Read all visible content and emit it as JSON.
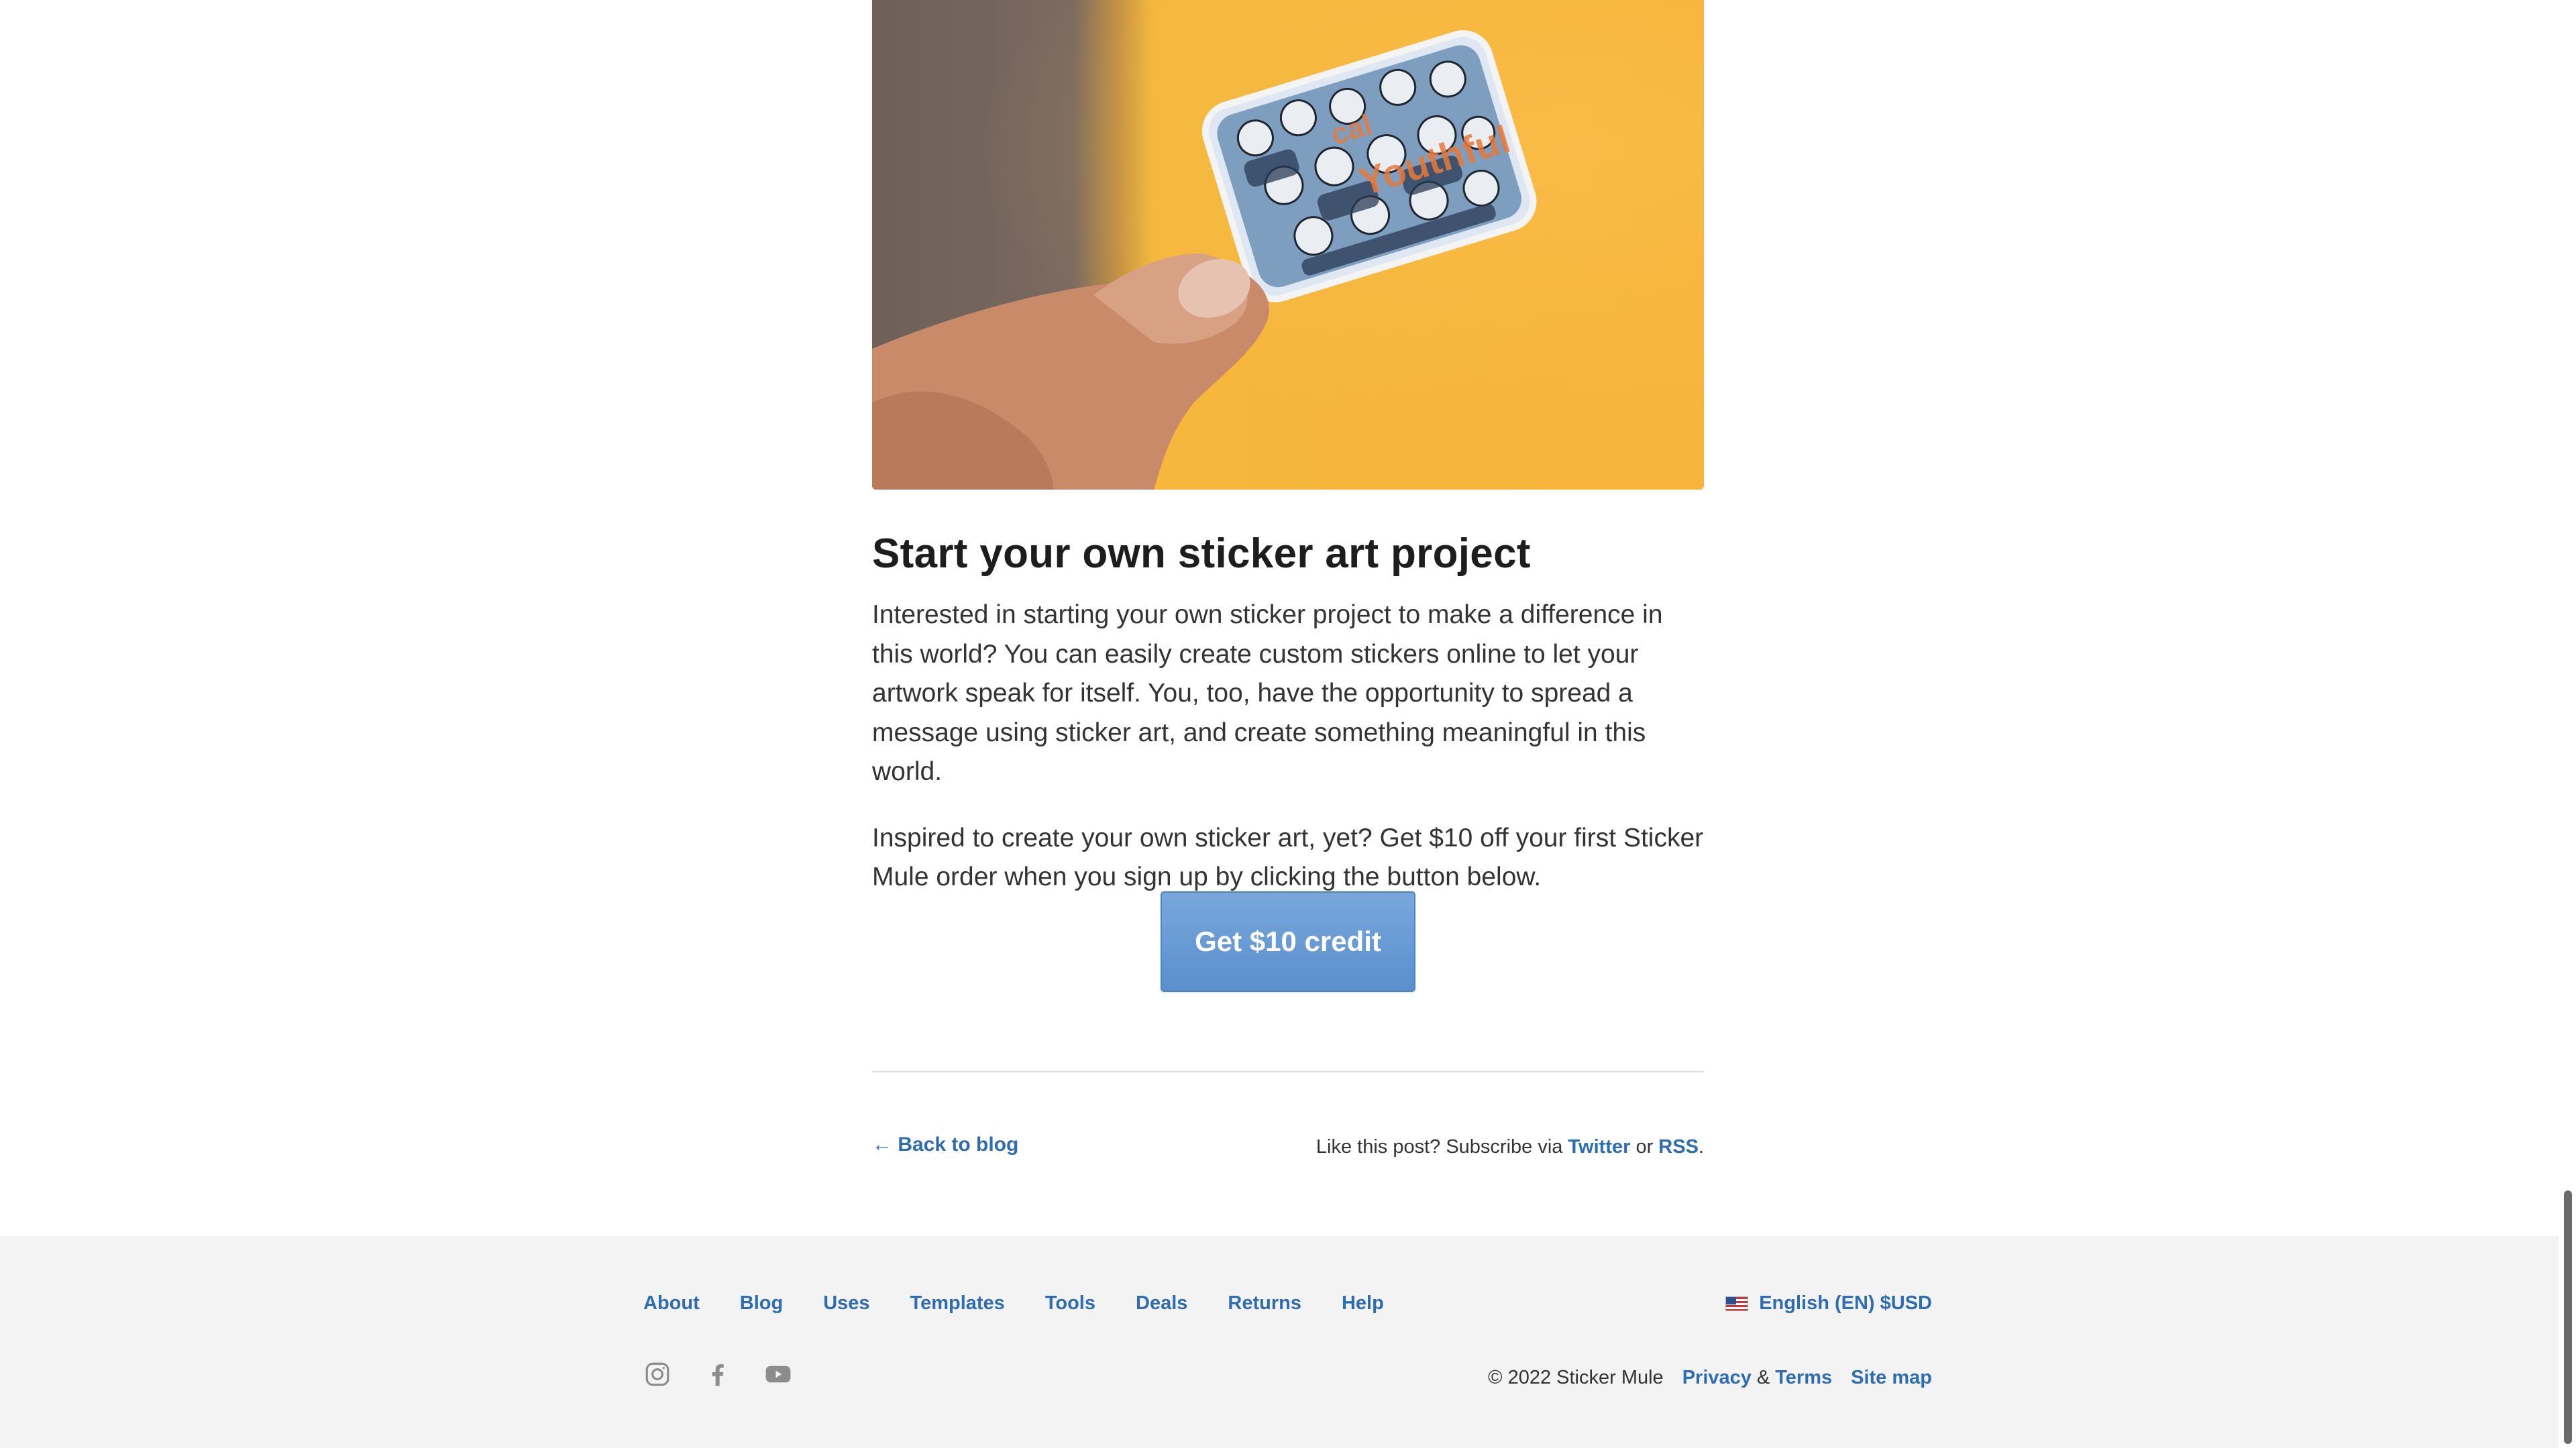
{
  "hero": {
    "alt": "Hand holding a sticker with illustrated portraits"
  },
  "article": {
    "title": "Start your own sticker art project",
    "paragraph1": "Interested in starting your own sticker project to make a difference in this world? You can easily create custom stickers online to let your artwork speak for itself. You, too, have the opportunity to spread a message using sticker art, and create something meaningful in this world.",
    "paragraph2": "Inspired to create your own sticker art, yet? Get $10 off your first Sticker Mule order when you sign up by clicking the button below.",
    "cta_label": "Get $10 credit"
  },
  "post_footer": {
    "back_label": "← Back to blog",
    "subscribe_prefix": "Like this post? Subscribe via ",
    "twitter_label": "Twitter",
    "or_text": " or ",
    "rss_label": "RSS",
    "period": "."
  },
  "footer": {
    "nav": [
      "About",
      "Blog",
      "Uses",
      "Templates",
      "Tools",
      "Deals",
      "Returns",
      "Help"
    ],
    "locale_label": "English (EN) $USD",
    "copyright": "© 2022 Sticker Mule",
    "privacy_label": "Privacy",
    "amp": "&",
    "terms_label": "Terms",
    "sitemap_label": "Site map",
    "social_icons": [
      "instagram-icon",
      "facebook-icon",
      "youtube-icon"
    ]
  },
  "colors": {
    "link": "#2f6db3",
    "cta": "#5a8fcd",
    "footer_bg": "#f3f3f3"
  }
}
